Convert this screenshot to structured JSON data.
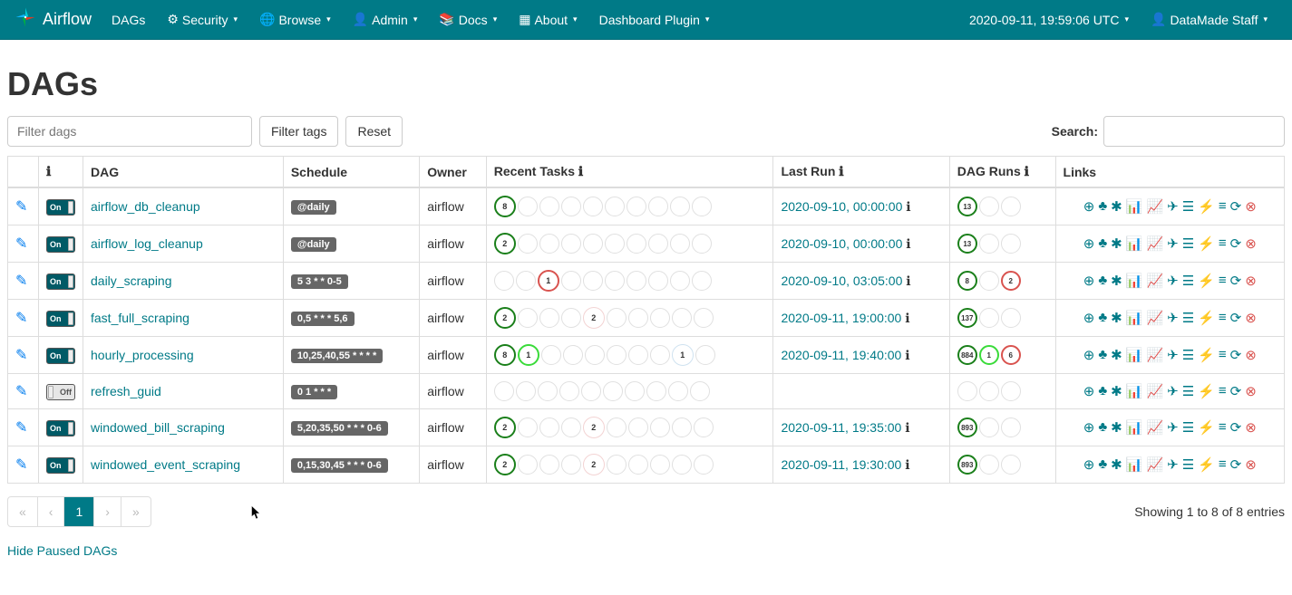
{
  "brand": "Airflow",
  "nav": {
    "dags": "DAGs",
    "security": "Security",
    "browse": "Browse",
    "admin": "Admin",
    "docs": "Docs",
    "about": "About",
    "dashboard": "Dashboard Plugin"
  },
  "clock": "2020-09-11, 19:59:06 UTC",
  "user": "DataMade Staff",
  "page_title": "DAGs",
  "filters": {
    "dags_placeholder": "Filter dags",
    "tags_btn": "Filter tags",
    "reset_btn": "Reset",
    "search_label": "Search:"
  },
  "columns": {
    "dag": "DAG",
    "schedule": "Schedule",
    "owner": "Owner",
    "recent_tasks": "Recent Tasks",
    "last_run": "Last Run",
    "dag_runs": "DAG Runs",
    "links": "Links"
  },
  "toggle_on": "On",
  "toggle_off": "Off",
  "rows": [
    {
      "on": true,
      "dag": "airflow_db_cleanup",
      "schedule": "@daily",
      "owner": "airflow",
      "tasks": [
        {
          "n": "8",
          "cls": "success"
        },
        "",
        "",
        "",
        "",
        "",
        "",
        "",
        "",
        ""
      ],
      "last_run": "2020-09-10, 00:00:00",
      "runs": [
        {
          "n": "13",
          "cls": "success"
        },
        "",
        ""
      ]
    },
    {
      "on": true,
      "dag": "airflow_log_cleanup",
      "schedule": "@daily",
      "owner": "airflow",
      "tasks": [
        {
          "n": "2",
          "cls": "success"
        },
        "",
        "",
        "",
        "",
        "",
        "",
        "",
        "",
        ""
      ],
      "last_run": "2020-09-10, 00:00:00",
      "runs": [
        {
          "n": "13",
          "cls": "success"
        },
        "",
        ""
      ]
    },
    {
      "on": true,
      "dag": "daily_scraping",
      "schedule": "5 3 * * 0-5",
      "owner": "airflow",
      "tasks": [
        "",
        "",
        {
          "n": "1",
          "cls": "failed"
        },
        "",
        "",
        "",
        "",
        "",
        "",
        ""
      ],
      "last_run": "2020-09-10, 03:05:00",
      "runs": [
        {
          "n": "8",
          "cls": "success"
        },
        "",
        {
          "n": "2",
          "cls": "failed"
        }
      ]
    },
    {
      "on": true,
      "dag": "fast_full_scraping",
      "schedule": "0,5 * * * 5,6",
      "owner": "airflow",
      "tasks": [
        {
          "n": "2",
          "cls": "success"
        },
        "",
        "",
        "",
        {
          "n": "2",
          "cls": "faded-pink"
        },
        "",
        "",
        "",
        "",
        ""
      ],
      "last_run": "2020-09-11, 19:00:00",
      "runs": [
        {
          "n": "137",
          "cls": "success"
        },
        "",
        ""
      ]
    },
    {
      "on": true,
      "dag": "hourly_processing",
      "schedule": "10,25,40,55 * * * *",
      "owner": "airflow",
      "tasks": [
        {
          "n": "8",
          "cls": "success"
        },
        {
          "n": "1",
          "cls": "running"
        },
        "",
        "",
        "",
        "",
        "",
        "",
        {
          "n": "1",
          "cls": "faded-blue"
        },
        ""
      ],
      "last_run": "2020-09-11, 19:40:00",
      "runs": [
        {
          "n": "884",
          "cls": "success"
        },
        {
          "n": "1",
          "cls": "running"
        },
        {
          "n": "6",
          "cls": "failed"
        }
      ]
    },
    {
      "on": false,
      "dag": "refresh_guid",
      "schedule": "0 1 * * *",
      "owner": "airflow",
      "tasks": [
        "",
        "",
        "",
        "",
        "",
        "",
        "",
        "",
        "",
        ""
      ],
      "last_run": "",
      "runs": [
        "",
        "",
        ""
      ]
    },
    {
      "on": true,
      "dag": "windowed_bill_scraping",
      "schedule": "5,20,35,50 * * * 0-6",
      "owner": "airflow",
      "tasks": [
        {
          "n": "2",
          "cls": "success"
        },
        "",
        "",
        "",
        {
          "n": "2",
          "cls": "faded-pink"
        },
        "",
        "",
        "",
        "",
        ""
      ],
      "last_run": "2020-09-11, 19:35:00",
      "runs": [
        {
          "n": "893",
          "cls": "success"
        },
        "",
        ""
      ]
    },
    {
      "on": true,
      "dag": "windowed_event_scraping",
      "schedule": "0,15,30,45 * * * 0-6",
      "owner": "airflow",
      "tasks": [
        {
          "n": "2",
          "cls": "success"
        },
        "",
        "",
        "",
        {
          "n": "2",
          "cls": "faded-pink"
        },
        "",
        "",
        "",
        "",
        ""
      ],
      "last_run": "2020-09-11, 19:30:00",
      "runs": [
        {
          "n": "893",
          "cls": "success"
        },
        "",
        ""
      ]
    }
  ],
  "entries_text": "Showing 1 to 8 of 8 entries",
  "pagination": {
    "first": "«",
    "prev": "‹",
    "current": "1",
    "next": "›",
    "last": "»"
  },
  "hide_paused": "Hide Paused DAGs"
}
